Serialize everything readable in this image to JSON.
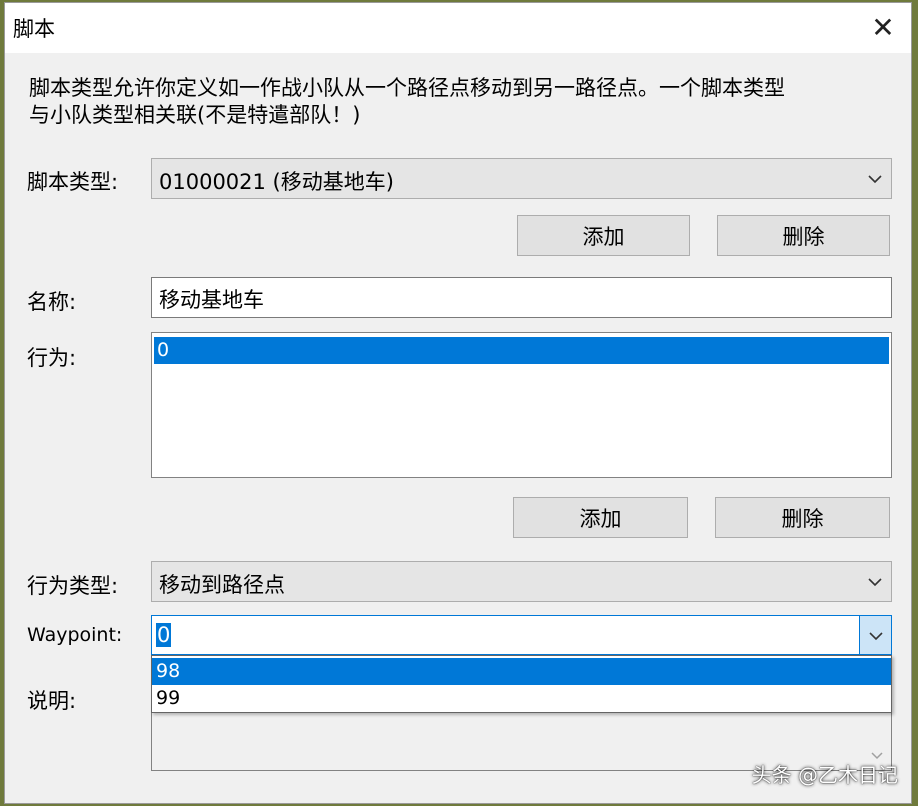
{
  "window": {
    "title": "脚本",
    "close_glyph": "✕"
  },
  "description": "脚本类型允许你定义如一作战小队从一个路径点移动到另一路径点。一个脚本类型\n与小队类型相关联(不是特遣部队！)",
  "script_type": {
    "label": "脚本类型:",
    "selected": "01000021 (移动基地车)",
    "add_button": "添加",
    "delete_button": "删除"
  },
  "name": {
    "label": "名称:",
    "value": "移动基地车"
  },
  "actions": {
    "label": "行为:",
    "items": [
      "0"
    ],
    "selected_index": 0,
    "add_button": "添加",
    "delete_button": "删除"
  },
  "action_type": {
    "label": "行为类型:",
    "selected": "移动到路径点"
  },
  "waypoint": {
    "label": "Waypoint:",
    "value": "0",
    "dropdown_options": [
      "98",
      "99"
    ],
    "highlighted_option": "98"
  },
  "notes": {
    "label": "说明:"
  },
  "watermark": "头条 @乙木日记",
  "colors": {
    "selection": "#0078d7",
    "dialog_bg": "#f0f0f0",
    "desktop_bg": "#6f7a3c"
  },
  "icons": {
    "close": "close-icon",
    "dropdown": "chevron-down-icon"
  }
}
